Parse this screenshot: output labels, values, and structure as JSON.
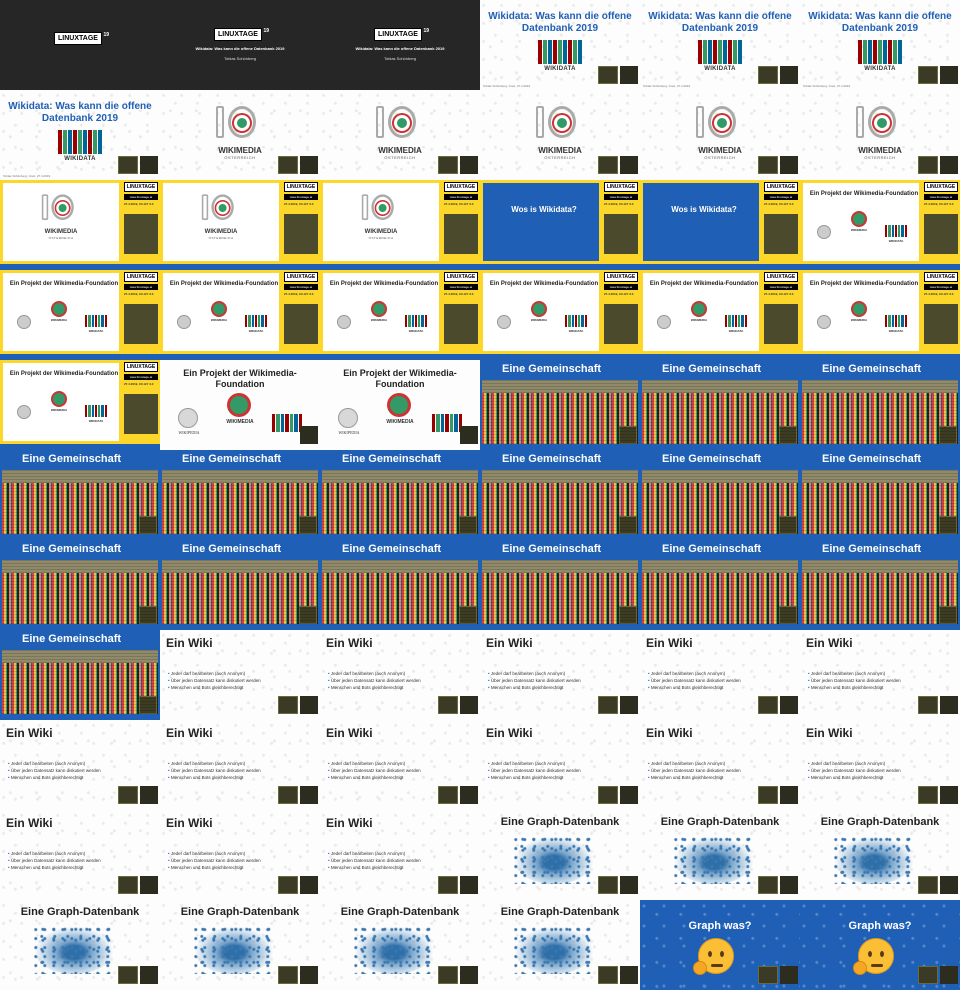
{
  "linuxtage": {
    "logo": "LINUXTAGE",
    "num": "19"
  },
  "talk": {
    "title": "Wikidata: Was kann die offene Datenbank 2019",
    "author": "Tobias Schönberg",
    "footer": "Tobias Schönberg, Graz, 27.4.2019"
  },
  "wikidata_word": "WIKIDATA",
  "wikimedia": {
    "word": "WIKIMEDIA",
    "sub": "ÖSTERREICH"
  },
  "sidebar": {
    "url": "www.linuxtage.at",
    "date": "27.4.2019, CC-BY 3.0"
  },
  "wos": "Wos is Wikidata?",
  "project": "Ein Projekt der Wikimedia-Foundation",
  "wmf": {
    "word": "WIKIMEDIA",
    "sub": "FOUNDATION"
  },
  "wikipedia": {
    "word": "WIKIPEDIA",
    "sub": "The Free Encyclopedia"
  },
  "community": "Eine Gemeinschaft",
  "wiki": {
    "title": "Ein Wiki",
    "bullets": [
      "Jeder darf bearbeiten (auch Anonym)",
      "Über jeden Datensatz kann diskutiert werden",
      "Menschen und Bots gleichberechtigt"
    ]
  },
  "graph": "Eine Graph-Datenbank",
  "graph_was": "Graph was?",
  "colors": {
    "blue": "#1f5fb5",
    "yellow": "#fcd628",
    "dark": "#262626"
  },
  "slides": [
    {
      "type": "title-badge"
    },
    {
      "type": "title-text"
    },
    {
      "type": "title-text"
    },
    {
      "type": "wd"
    },
    {
      "type": "wd"
    },
    {
      "type": "wd"
    },
    {
      "type": "wd"
    },
    {
      "type": "wm"
    },
    {
      "type": "wm"
    },
    {
      "type": "wm"
    },
    {
      "type": "wm"
    },
    {
      "type": "wm"
    },
    {
      "type": "y-wm"
    },
    {
      "type": "y-wm"
    },
    {
      "type": "y-wm"
    },
    {
      "type": "y-wos"
    },
    {
      "type": "y-wos"
    },
    {
      "type": "y-proj"
    },
    {
      "type": "y-proj"
    },
    {
      "type": "y-proj"
    },
    {
      "type": "y-proj"
    },
    {
      "type": "y-proj"
    },
    {
      "type": "y-proj"
    },
    {
      "type": "y-proj"
    },
    {
      "type": "y-proj"
    },
    {
      "type": "proj"
    },
    {
      "type": "proj"
    },
    {
      "type": "gem"
    },
    {
      "type": "gem"
    },
    {
      "type": "gem"
    },
    {
      "type": "gem"
    },
    {
      "type": "gem"
    },
    {
      "type": "gem"
    },
    {
      "type": "gem"
    },
    {
      "type": "gem"
    },
    {
      "type": "gem"
    },
    {
      "type": "gem"
    },
    {
      "type": "gem"
    },
    {
      "type": "gem"
    },
    {
      "type": "gem"
    },
    {
      "type": "gem"
    },
    {
      "type": "gem"
    },
    {
      "type": "gem"
    },
    {
      "type": "wiki"
    },
    {
      "type": "wiki"
    },
    {
      "type": "wiki"
    },
    {
      "type": "wiki"
    },
    {
      "type": "wiki"
    },
    {
      "type": "wiki"
    },
    {
      "type": "wiki"
    },
    {
      "type": "wiki"
    },
    {
      "type": "wiki"
    },
    {
      "type": "wiki"
    },
    {
      "type": "wiki"
    },
    {
      "type": "wiki"
    },
    {
      "type": "wiki"
    },
    {
      "type": "wiki"
    },
    {
      "type": "graph"
    },
    {
      "type": "graph"
    },
    {
      "type": "graph"
    },
    {
      "type": "graph"
    },
    {
      "type": "graph"
    },
    {
      "type": "graph"
    },
    {
      "type": "graph"
    },
    {
      "type": "gw"
    },
    {
      "type": "gw"
    }
  ]
}
